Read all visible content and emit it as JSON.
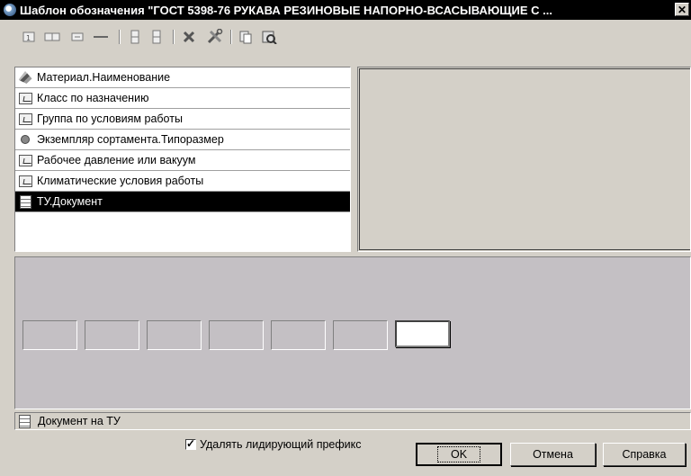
{
  "window": {
    "title": "Шаблон обозначения \"ГОСТ 5398-76 РУКАВА РЕЗИНОВЫЕ НАПОРНО-ВСАСЫВАЮЩИЕ С ...",
    "close_label": "✕"
  },
  "attributes": [
    {
      "label": "Материал.Наименование",
      "icon": "material-icon",
      "selected": false
    },
    {
      "label": "Класс по назначению",
      "icon": "attribute-card-icon",
      "selected": false
    },
    {
      "label": "Группа по условиям работы",
      "icon": "attribute-card-icon",
      "selected": false
    },
    {
      "label": "Экземпляр сортамента.Типоразмер",
      "icon": "bullet-icon",
      "selected": false
    },
    {
      "label": "Рабочее давление или вакуум",
      "icon": "attribute-card-icon",
      "selected": false
    },
    {
      "label": "Климатические условия работы",
      "icon": "attribute-card-icon",
      "selected": false
    },
    {
      "label": "ТУ.Документ",
      "icon": "document-icon",
      "selected": true
    }
  ],
  "status_text": "Документ на ТУ",
  "checkbox": {
    "label": "Удалять лидирующий префикс",
    "checked": true
  },
  "buttons": {
    "ok": "OK",
    "cancel": "Отмена",
    "help": "Справка"
  }
}
